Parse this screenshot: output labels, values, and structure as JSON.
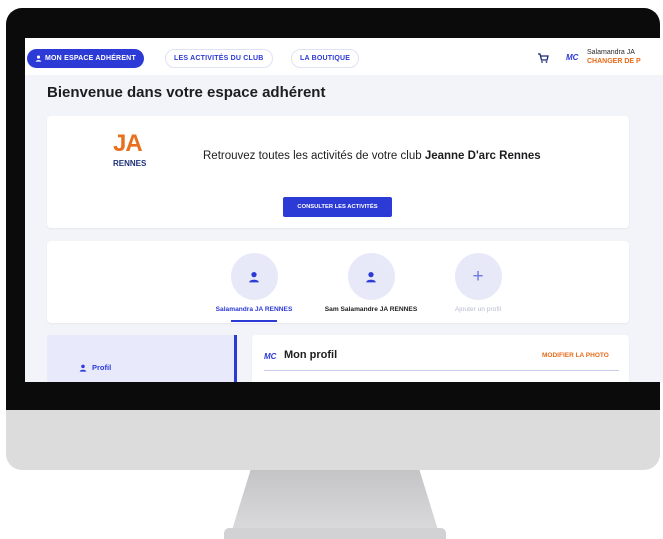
{
  "nav": {
    "tabs": [
      {
        "label": "MON ESPACE ADHÉRENT",
        "active": true
      },
      {
        "label": "LES ACTIVITÉS DU CLUB",
        "active": false
      },
      {
        "label": "LA BOUTIQUE",
        "active": false
      }
    ],
    "user_logo": "MC",
    "user_name": "Salamandra JA",
    "change_link": "CHANGER DE P"
  },
  "page": {
    "title": "Bienvenue dans votre espace adhérent"
  },
  "club": {
    "logo_top": "JA",
    "logo_bottom": "RENNES",
    "welcome_prefix": "Retrouvez toutes les activités de votre club ",
    "club_name": "Jeanne D'arc Rennes",
    "cta_label": "CONSULTER LES ACTIVITÉS"
  },
  "profiles": [
    {
      "label": "Salamandra JA RENNES",
      "selected": true
    },
    {
      "label": "Sam Salamandre JA RENNES",
      "selected": false
    }
  ],
  "add_profile_label": "Ajouter un profil",
  "sidebar": {
    "items": [
      {
        "label": "Profil",
        "icon": "person-icon",
        "active": true
      }
    ]
  },
  "my_profile": {
    "logo": "MC",
    "title": "Mon profil",
    "edit_photo_label": "MODIFIER LA PHOTO"
  },
  "colors": {
    "accent": "#2c3ad6",
    "orange": "#e86b1a",
    "background": "#f3f4f9"
  }
}
